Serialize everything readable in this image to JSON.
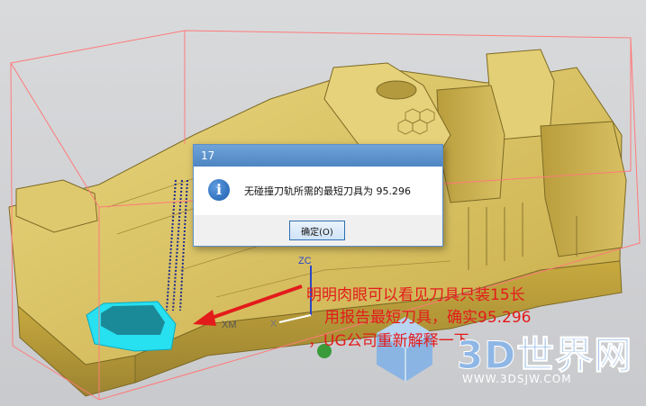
{
  "dialog": {
    "title": "17",
    "message": "无碰撞刀轨所需的最短刀具为 95.296",
    "ok_button_label": "确定(O)",
    "icon": "info-icon"
  },
  "annotation": {
    "line1": "明明肉眼可以看见刀具只装15长",
    "line2": "用报告最短刀具，确实95.296",
    "line3": "，UG公司重新解释一下",
    "color": "#e31b1b"
  },
  "axes": {
    "zc": "ZC",
    "xm": "XM",
    "x": "X"
  },
  "watermark": {
    "logo_text": "3D世界网",
    "url": "WWW.3DSJW.COM"
  },
  "colors": {
    "part": "#d8c063",
    "bounding_box": "#ff7a7a",
    "pocket_highlight": "#27e0f0",
    "dialog_title": "#4e86c2"
  }
}
